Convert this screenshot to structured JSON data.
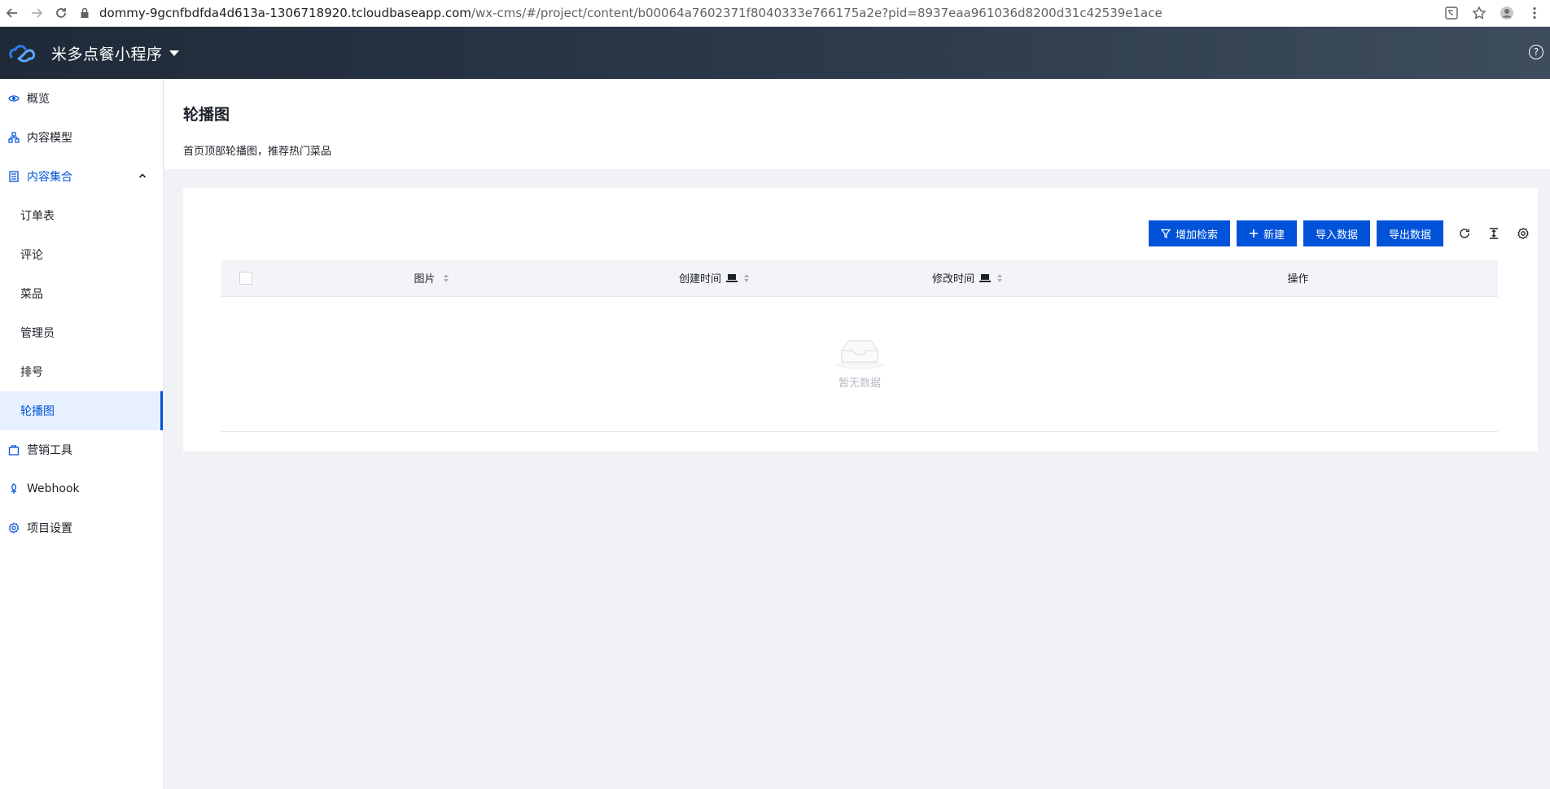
{
  "browser": {
    "url_host": "dommy-9gcnfbdfda4d613a-1306718920.tcloudbaseapp.com",
    "url_rest": "/wx-cms/#/project/content/b00064a7602371f8040333e766175a2e?pid=8937eaa961036d8200d31c42539e1ace"
  },
  "header": {
    "project_name": "米多点餐小程序",
    "help": "?"
  },
  "sidebar": {
    "items": [
      {
        "label": "概览",
        "icon": "eye-icon"
      },
      {
        "label": "内容模型",
        "icon": "model-icon"
      },
      {
        "label": "内容集合",
        "icon": "collection-icon"
      },
      {
        "label": "订单表"
      },
      {
        "label": "评论"
      },
      {
        "label": "菜品"
      },
      {
        "label": "管理员"
      },
      {
        "label": "排号"
      },
      {
        "label": "轮播图"
      },
      {
        "label": "营销工具",
        "icon": "marketing-icon"
      },
      {
        "label": "Webhook",
        "icon": "webhook-icon"
      },
      {
        "label": "项目设置",
        "icon": "gear-icon"
      }
    ]
  },
  "page": {
    "title": "轮播图",
    "description": "首页顶部轮播图，推荐热门菜品"
  },
  "toolbar": {
    "filter_label": "增加检索",
    "new_label": "新建",
    "import_label": "导入数据",
    "export_label": "导出数据"
  },
  "table": {
    "columns": [
      "图片",
      "创建时间",
      "修改时间",
      "操作"
    ],
    "empty_text": "暂无数据"
  },
  "colors": {
    "primary": "#0052d9",
    "header_bg": "#2c3a4b"
  }
}
